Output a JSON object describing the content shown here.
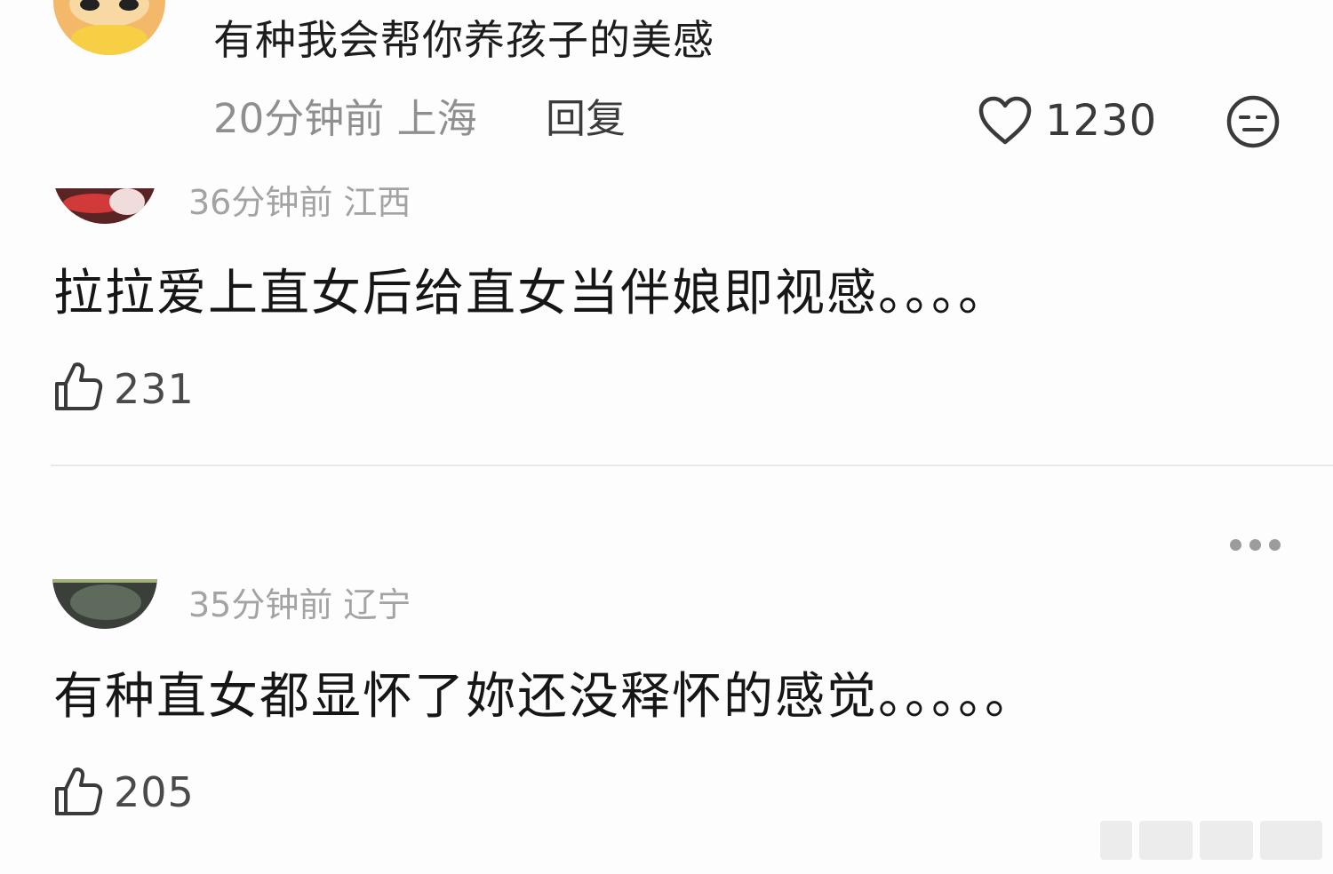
{
  "top_comment": {
    "avatar": "cartoon-avatar",
    "text": "有种我会帮你养孩子的美感",
    "meta": "20分钟前 上海",
    "reply_label": "回复",
    "like_icon": "heart-icon",
    "like_count": "1230",
    "reaction_icon": "expressionless-face-icon"
  },
  "comments": [
    {
      "avatar": "user-avatar",
      "meta": "36分钟前 江西",
      "text": "拉拉爱上直女后给直女当伴娘即视感。。。。",
      "like_icon": "thumbs-up-icon",
      "like_count": "231"
    },
    {
      "avatar": "user-avatar",
      "meta": "35分钟前 辽宁",
      "text": "有种直女都显怀了妳还没释怀的感觉。。。。。",
      "like_icon": "thumbs-up-icon",
      "like_count": "205"
    }
  ],
  "more_icon": "more-dots-icon",
  "colors": {
    "background": "#fdfdfd",
    "primary_text": "#161616",
    "secondary_text": "#a3a3a3",
    "divider": "#e7e7e7"
  }
}
